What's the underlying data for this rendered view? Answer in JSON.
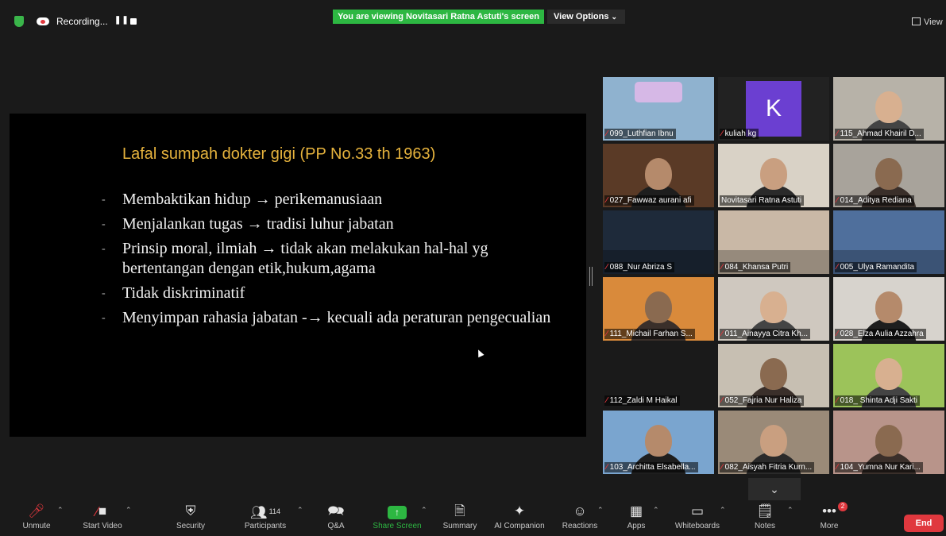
{
  "topbar": {
    "recording_label": "Recording...",
    "viewing_banner": "You are viewing Novitasari Ratna Astuti's screen",
    "view_options_label": "View Options",
    "view_label": "View"
  },
  "slide": {
    "title": "Lafal sumpah dokter gigi (PP No.33 th 1963)",
    "bullets": [
      "Membaktikan hidup  → perikemanusiaan",
      "Menjalankan tugas    →  tradisi luhur jabatan",
      "Prinsip moral, ilmiah  → tidak akan melakukan hal-hal yg bertentangan dengan etik,hukum,agama",
      "Tidak diskriminatif",
      "Menyimpan rahasia jabatan -→ kecuali ada peraturan pengecualian"
    ]
  },
  "participants": [
    {
      "name": "099_Luthfian Ibnu",
      "muted": true,
      "bg": "#8fb2cf",
      "kind": "logo"
    },
    {
      "name": "kuliah kg",
      "muted": true,
      "bg": "#222222",
      "kind": "avatar",
      "initial": "K"
    },
    {
      "name": "115_Ahmad Khairil D...",
      "muted": true,
      "bg": "#b7b2a8",
      "kind": "person"
    },
    {
      "name": "027_Fawwaz aurani afi",
      "muted": true,
      "bg": "#5a3a26",
      "kind": "person"
    },
    {
      "name": "Novitasari Ratna Astuti",
      "muted": false,
      "bg": "#d9d2c6",
      "kind": "person",
      "active": true
    },
    {
      "name": "014_Aditya Rediana",
      "muted": true,
      "bg": "#a8a39b",
      "kind": "person"
    },
    {
      "name": "088_Nur Abriza S",
      "muted": true,
      "bg": "#1e2a3a",
      "kind": "scene"
    },
    {
      "name": "084_Khansa Putri",
      "muted": true,
      "bg": "#c9b8a6",
      "kind": "scene"
    },
    {
      "name": "005_Ulya Ramandita",
      "muted": true,
      "bg": "#4f6f9c",
      "kind": "scene"
    },
    {
      "name": "111_Michail Farhan S...",
      "muted": true,
      "bg": "#d98a3b",
      "kind": "person"
    },
    {
      "name": "011_Ainayya Citra Kh...",
      "muted": true,
      "bg": "#cfc8bf",
      "kind": "person"
    },
    {
      "name": "028_Elza Aulia Azzahra",
      "muted": true,
      "bg": "#d7d3cd",
      "kind": "person"
    },
    {
      "name": "112_Zaldi M Haikal",
      "muted": true,
      "bg": "#1a1a1a",
      "kind": "none"
    },
    {
      "name": "052_Fajria Nur Haliza",
      "muted": true,
      "bg": "#c7bfb2",
      "kind": "person"
    },
    {
      "name": "018_ Shinta Adji Sakti",
      "muted": true,
      "bg": "#9cc35a",
      "kind": "person"
    },
    {
      "name": "103_Architta Elsabella...",
      "muted": true,
      "bg": "#7aa5cf",
      "kind": "person"
    },
    {
      "name": "082_Aisyah Fitria Kurn...",
      "muted": true,
      "bg": "#9a8a78",
      "kind": "person"
    },
    {
      "name": "104_Yumna Nur Kari...",
      "muted": true,
      "bg": "#b8948a",
      "kind": "person"
    }
  ],
  "toolbar": {
    "unmute": "Unmute",
    "start_video": "Start Video",
    "security": "Security",
    "participants": "Participants",
    "participants_count": "114",
    "qa": "Q&A",
    "share_screen": "Share Screen",
    "summary": "Summary",
    "ai_companion": "AI Companion",
    "reactions": "Reactions",
    "apps": "Apps",
    "whiteboards": "Whiteboards",
    "notes": "Notes",
    "more": "More",
    "more_badge": "2",
    "end": "End"
  },
  "colors": {
    "accent_green": "#2db742",
    "end_red": "#e0383e",
    "slide_title": "#e6b33d",
    "active_speaker": "#c7e34a"
  }
}
